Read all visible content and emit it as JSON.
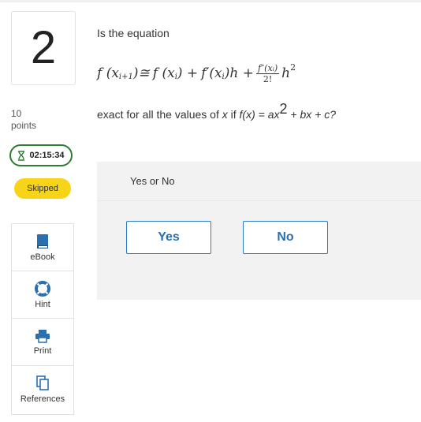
{
  "question": {
    "number": "2",
    "points_value": "10",
    "points_label": "points",
    "timer": "02:15:34",
    "status": "Skipped",
    "intro": "Is the equation",
    "condition_prefix": "exact for all the values of ",
    "condition_var_x": "x",
    "condition_mid": " if ",
    "condition_func": "f(x) = ax",
    "condition_exp": "2",
    "condition_suffix": " + bx + c?"
  },
  "equation": {
    "lhs": "f (x",
    "lhs_sub": "i+1",
    "approx": ")≅",
    "term1": "f (x",
    "term1_sub": "i",
    "term1_close": ") +",
    "term2": "f′(x",
    "term2_sub": "i",
    "term2_close": ")h +",
    "frac_num": "f″(xᵢ)",
    "frac_den": "2!",
    "h2": "h",
    "h2_exp": "2"
  },
  "answer": {
    "prompt": "Yes or No",
    "options": [
      "Yes",
      "No"
    ]
  },
  "tools": [
    {
      "label": "eBook",
      "icon": "book-icon"
    },
    {
      "label": "Hint",
      "icon": "lifebuoy-icon"
    },
    {
      "label": "Print",
      "icon": "printer-icon"
    },
    {
      "label": "References",
      "icon": "copy-icon"
    }
  ],
  "colors": {
    "accent_blue": "#2a6fb0",
    "timer_green": "#2e7d32",
    "skipped_yellow": "#f7d417",
    "panel_gray": "#f2f2f2"
  }
}
